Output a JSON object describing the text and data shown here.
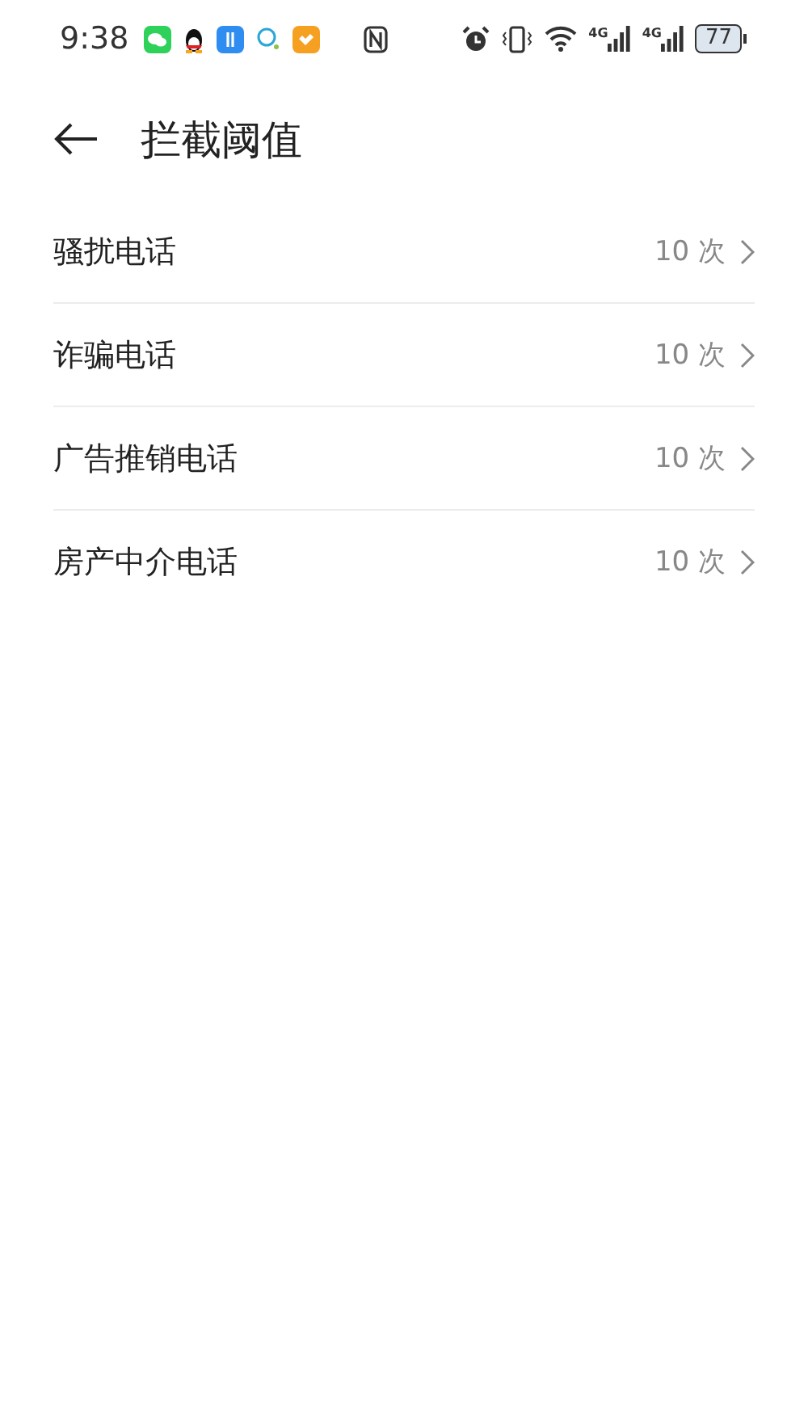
{
  "status_bar": {
    "time": "9:38",
    "signals": [
      {
        "network": "4G"
      },
      {
        "network": "4G"
      }
    ],
    "battery": "77"
  },
  "header": {
    "title": "拦截阈值"
  },
  "items": [
    {
      "label": "骚扰电话",
      "value": "10 次"
    },
    {
      "label": "诈骗电话",
      "value": "10 次"
    },
    {
      "label": "广告推销电话",
      "value": "10 次"
    },
    {
      "label": "房产中介电话",
      "value": "10 次"
    }
  ]
}
